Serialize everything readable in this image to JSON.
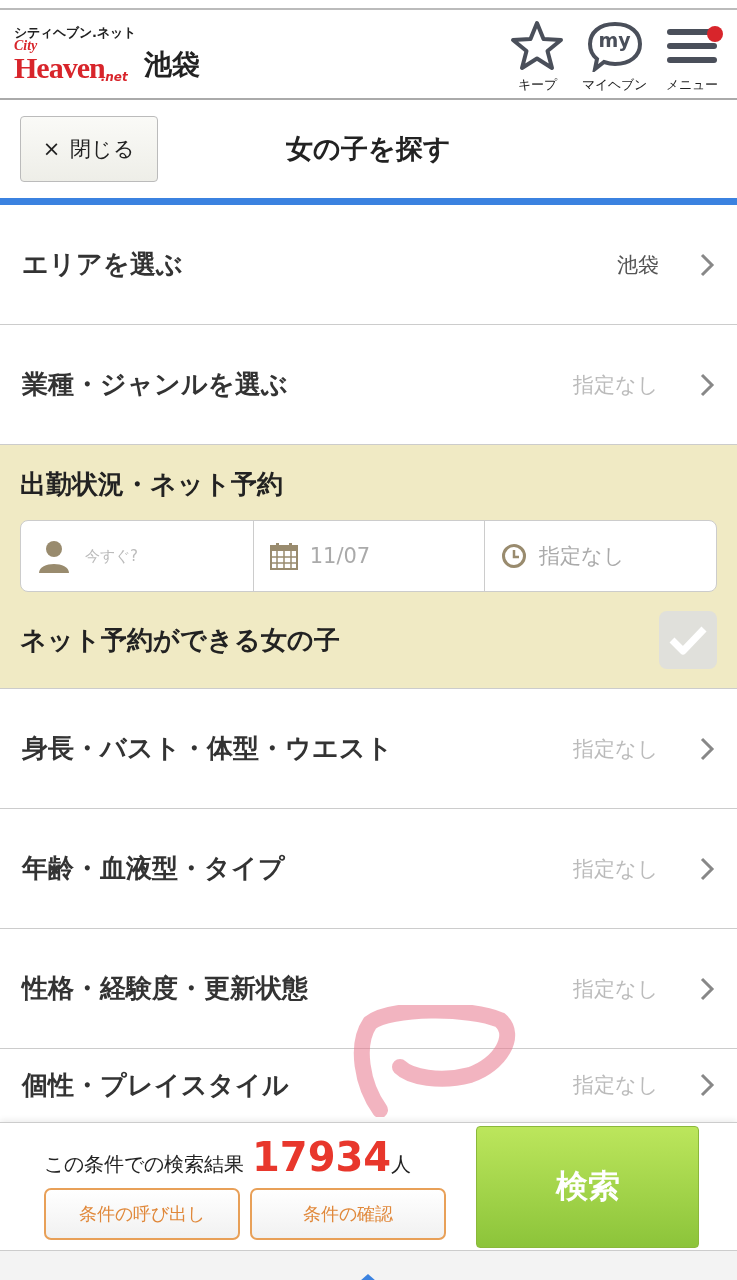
{
  "header": {
    "logo": {
      "kana": "シティヘブン.ネット",
      "city": "City",
      "heaven": "Heaven",
      "net": ".net"
    },
    "location": "池袋",
    "actions": [
      {
        "kind": "star",
        "label": "キープ",
        "notification": false
      },
      {
        "kind": "my",
        "label": "マイヘブン",
        "icon_text": "my",
        "notification": false
      },
      {
        "kind": "menu",
        "label": "メニュー",
        "notification": true
      }
    ]
  },
  "subheader": {
    "close_icon": "×",
    "close_button": "閉じる",
    "title": "女の子を探す"
  },
  "filters": [
    {
      "kind": "link",
      "label": "エリアを選ぶ",
      "value": "池袋",
      "value_set": true
    },
    {
      "kind": "link",
      "label": "業種・ジャンルを選ぶ",
      "value": "指定なし",
      "value_set": false
    },
    {
      "kind": "availability",
      "label": "出勤状況・ネット予約",
      "fields": [
        {
          "kind": "person",
          "placeholder": "今すぐ?"
        },
        {
          "kind": "calendar",
          "value": "11/07"
        },
        {
          "kind": "clock",
          "value": "指定なし"
        }
      ],
      "checkbox": {
        "label": "ネット予約ができる女の子",
        "checked": false
      }
    },
    {
      "kind": "link",
      "label": "身長・バスト・体型・ウエスト",
      "value": "指定なし",
      "value_set": false
    },
    {
      "kind": "link",
      "label": "年齢・血液型・タイプ",
      "value": "指定なし",
      "value_set": false
    },
    {
      "kind": "link",
      "label": "性格・経験度・更新状態",
      "value": "指定なし",
      "value_set": false
    },
    {
      "kind": "link",
      "label": "個性・プレイスタイル",
      "value": "指定なし",
      "value_set": false
    }
  ],
  "footer": {
    "result_label": "この条件での検索結果",
    "count": "17934",
    "unit": "人",
    "buttons": [
      "条件の呼び出し",
      "条件の確認"
    ],
    "search_button": "検索"
  }
}
